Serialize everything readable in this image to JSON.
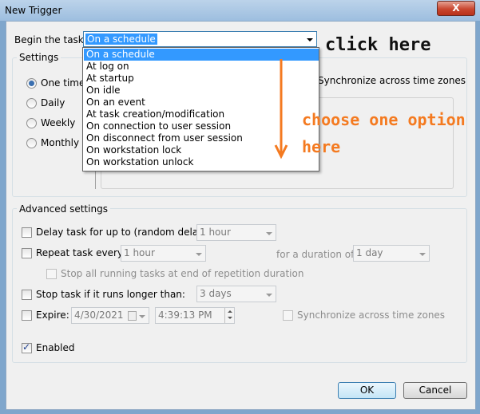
{
  "window": {
    "title": "New Trigger",
    "close_label": "X"
  },
  "begin_task": {
    "label": "Begin the task:",
    "selected": "On a schedule",
    "options": [
      "On a schedule",
      "At log on",
      "At startup",
      "On idle",
      "On an event",
      "At task creation/modification",
      "On connection to user session",
      "On disconnect from user session",
      "On workstation lock",
      "On workstation unlock"
    ]
  },
  "settings": {
    "title": "Settings",
    "radios": [
      "One time",
      "Daily",
      "Weekly",
      "Monthly"
    ],
    "checked_index": 0,
    "sync_label": "Synchronize across time zones"
  },
  "advanced": {
    "title": "Advanced settings",
    "delay_label": "Delay task for up to (random delay):",
    "delay_value": "1 hour",
    "repeat_label": "Repeat task every:",
    "repeat_value": "1 hour",
    "duration_label": "for a duration of:",
    "duration_value": "1 day",
    "stop_running_label": "Stop all running tasks at end of repetition duration",
    "stop_longer_label": "Stop task if it runs longer than:",
    "stop_longer_value": "3 days",
    "expire_label": "Expire:",
    "expire_date": "4/30/2021",
    "expire_time": "4:39:13 PM",
    "expire_sync_label": "Synchronize across time zones",
    "enabled_label": "Enabled",
    "enabled_checked": true
  },
  "buttons": {
    "ok": "OK",
    "cancel": "Cancel"
  },
  "annotations": {
    "click_here": "click here",
    "choose_line1": "choose one option",
    "choose_line2": "here",
    "arrow_color": "#f47a20"
  }
}
